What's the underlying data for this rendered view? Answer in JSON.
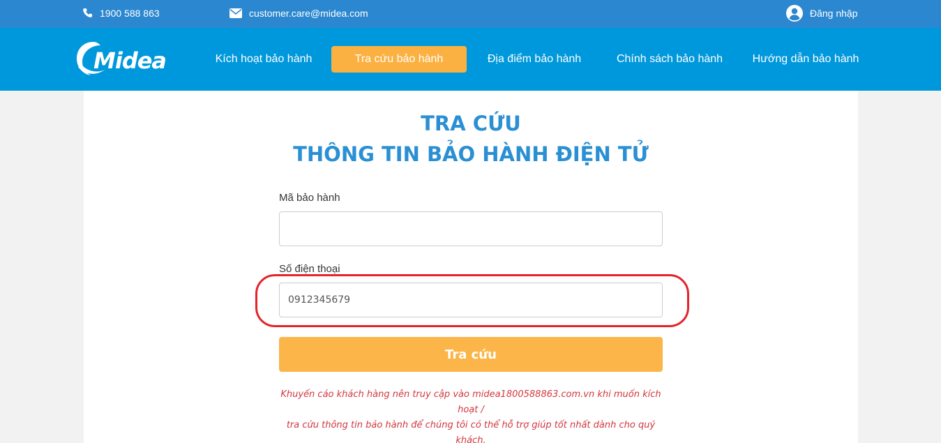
{
  "topbar": {
    "phone": "1900 588 863",
    "email": "customer.care@midea.com",
    "login": "Đăng nhập"
  },
  "brand": {
    "name": "Midea"
  },
  "nav": {
    "items": [
      {
        "label": "Kích hoạt bảo hành"
      },
      {
        "label": "Tra cứu bảo hành",
        "active": true
      },
      {
        "label": "Địa điểm bảo hành"
      },
      {
        "label": "Chính sách bảo hành"
      },
      {
        "label": "Hướng dẫn bảo hành"
      }
    ]
  },
  "page": {
    "title_line1": "TRA CỨU",
    "title_line2": "THÔNG TIN BẢO HÀNH ĐIỆN TỬ"
  },
  "form": {
    "warranty_code_label": "Mã bảo hành",
    "warranty_code_value": "",
    "phone_label": "Số điện thoại",
    "phone_value": "0912345679",
    "submit_label": "Tra cứu"
  },
  "note": {
    "line1": "Khuyến cáo khách hàng nên truy cập vào midea1800588863.com.vn khi muốn kích hoạt /",
    "line2": "tra cứu thông tin bảo hành để chúng tôi có thể hỗ trợ giúp tốt nhất dành cho quý khách."
  },
  "colors": {
    "topbar": "#2b87cf",
    "navbar": "#0098dc",
    "accent": "#fbb141",
    "title": "#2a8fd3",
    "note": "#d2363e",
    "highlight": "#e4232b"
  },
  "icons": [
    "phone-icon",
    "envelope-icon",
    "user-icon"
  ]
}
